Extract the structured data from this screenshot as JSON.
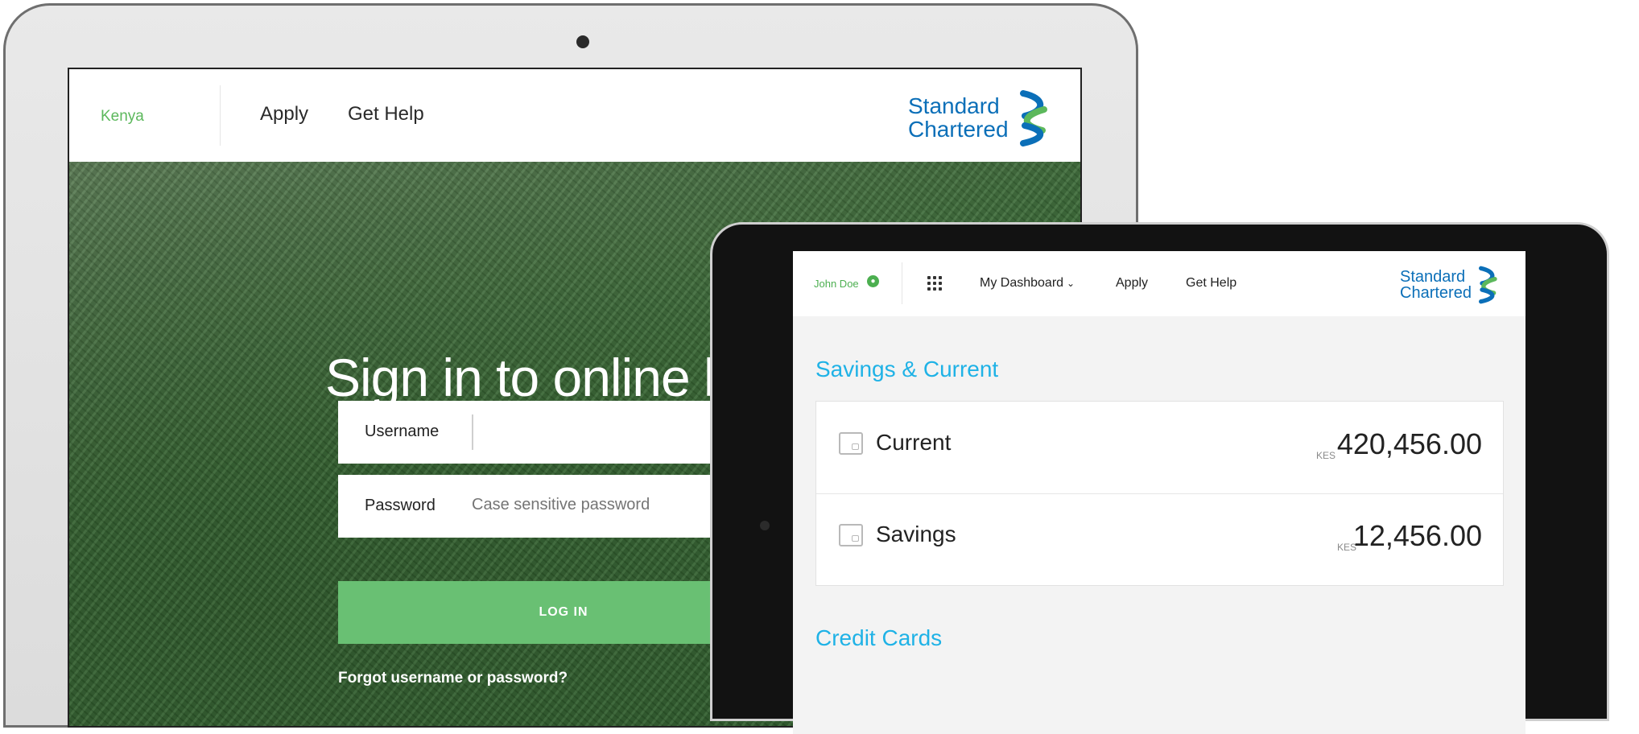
{
  "laptop": {
    "nav": {
      "country": "Kenya",
      "links": [
        "Apply",
        "Get Help"
      ],
      "logo": {
        "line1": "Standard",
        "line2": "Chartered"
      }
    },
    "login": {
      "title": "Sign in to online ba",
      "username_label": "Username",
      "username_value": "",
      "password_label": "Password",
      "password_placeholder": "Case sensitive password",
      "login_button": "LOG IN",
      "forgot_link": "Forgot username or password?"
    }
  },
  "tablet": {
    "nav": {
      "user_name": "John Doe",
      "links": [
        "My Dashboard",
        "Apply",
        "Get Help"
      ],
      "logo": {
        "line1": "Standard",
        "line2": "Chartered"
      }
    },
    "sections": {
      "savings_title": "Savings & Current",
      "credit_title": "Credit Cards"
    },
    "accounts": [
      {
        "name": "Current",
        "currency": "KES",
        "amount": "420,456.00"
      },
      {
        "name": "Savings",
        "currency": "KES",
        "amount": "12,456.00"
      }
    ]
  },
  "colors": {
    "brand_blue": "#0b6fb8",
    "brand_green": "#4caf50",
    "login_button": "#69c073",
    "section_title": "#1fb2e6"
  },
  "icons": [
    "user-circle-icon",
    "app-grid-icon",
    "chevron-down-icon",
    "wallet-icon",
    "fingerprint-icon",
    "sc-logo-mark"
  ]
}
